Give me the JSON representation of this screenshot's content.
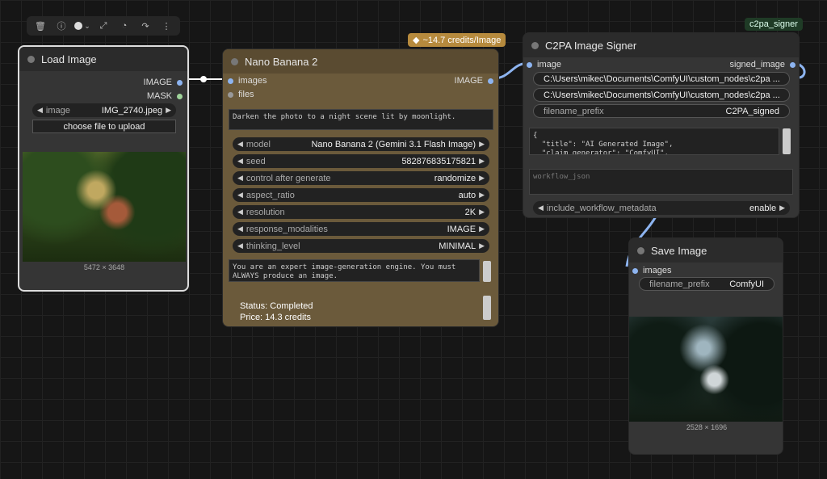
{
  "toolbar": {
    "icons": [
      "trash-icon",
      "info-icon",
      "color-dot-icon",
      "fit-icon",
      "pie-icon",
      "redo-icon",
      "more-icon"
    ],
    "chev": "⌄"
  },
  "load_image": {
    "title": "Load Image",
    "out_image": "IMAGE",
    "out_mask": "MASK",
    "image_label": "image",
    "image_value": "IMG_2740.jpeg",
    "upload_label": "choose file to upload",
    "dims": "5472 × 3648"
  },
  "banana": {
    "badge": "~14.7 credits/Image",
    "title": "Nano Banana 2",
    "in_images": "images",
    "in_files": "files",
    "out_image": "IMAGE",
    "prompt": "Darken the photo to a night scene lit by moonlight.",
    "widgets": [
      {
        "label": "model",
        "value": "Nano Banana 2 (Gemini 3.1 Flash Image)"
      },
      {
        "label": "seed",
        "value": "582876835175821"
      },
      {
        "label": "control after generate",
        "value": "randomize"
      },
      {
        "label": "aspect_ratio",
        "value": "auto"
      },
      {
        "label": "resolution",
        "value": "2K"
      },
      {
        "label": "response_modalities",
        "value": "IMAGE"
      },
      {
        "label": "thinking_level",
        "value": "MINIMAL"
      }
    ],
    "system_prompt": "You are an expert image-generation engine. You must ALWAYS produce an image.\nInterpret all user input—regardless of format, intent, or",
    "status": "Status: Completed",
    "price": "Price: 14.3 credits"
  },
  "c2pa": {
    "tag": "c2pa_signer",
    "title": "C2PA Image Signer",
    "in_image": "image",
    "out_signed": "signed_image",
    "path1": "C:\\Users\\mikec\\Documents\\ComfyUI\\custom_nodes\\c2pa ...",
    "path2": "C:\\Users\\mikec\\Documents\\ComfyUI\\custom_nodes\\c2pa ...",
    "prefix_label": "filename_prefix",
    "prefix_value": "C2PA_signed",
    "json_text": "{\n  \"title\": \"AI Generated Image\",\n  \"claim_generator\": \"ComfyUI\",",
    "workflow_placeholder": "workflow_json",
    "include_label": "include_workflow_metadata",
    "include_value": "enable"
  },
  "save_image": {
    "title": "Save Image",
    "in_images": "images",
    "prefix_label": "filename_prefix",
    "prefix_value": "ComfyUI",
    "dims": "2528 × 1696"
  },
  "colors": {
    "accent": "#8db4f0",
    "badge": "#b68a3d",
    "banana_body": "#6b5a3b",
    "mask_port": "#9fd39a"
  }
}
